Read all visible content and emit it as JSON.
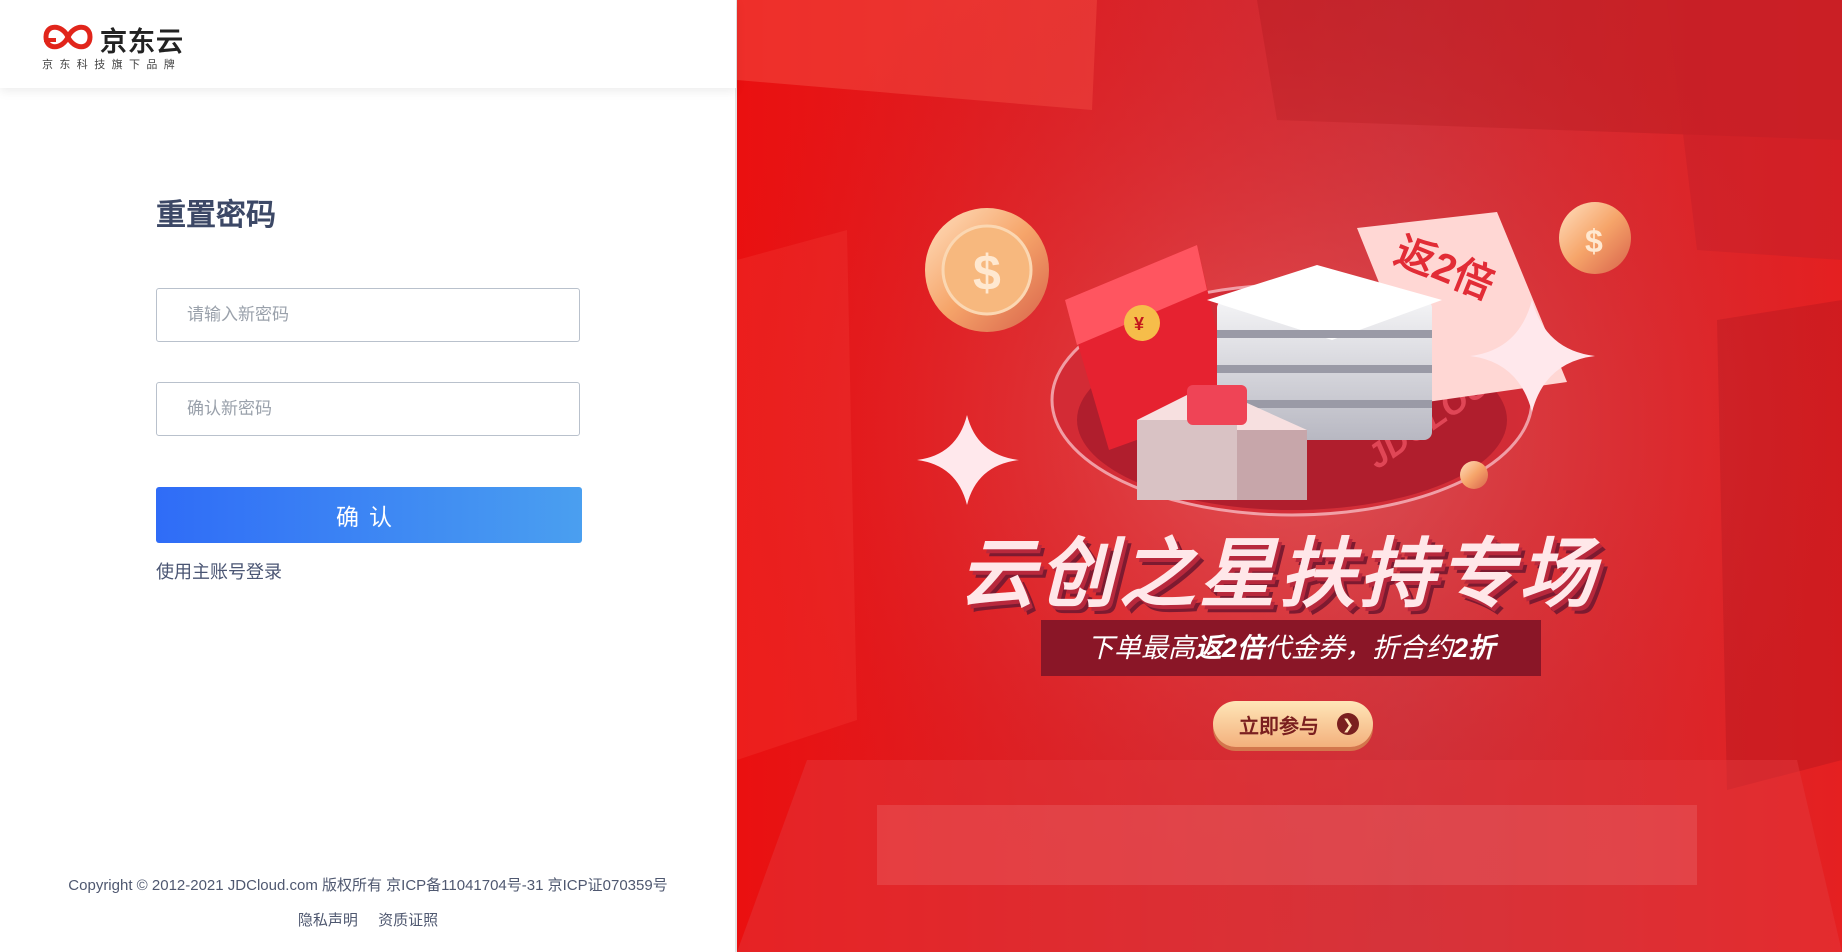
{
  "brand": {
    "name": "京东云",
    "tagline": "京东科技旗下品牌",
    "logo_color": "#e1251b"
  },
  "form": {
    "title": "重置密码",
    "new_password_placeholder": "请输入新密码",
    "confirm_password_placeholder": "确认新密码",
    "confirm_label": "确认",
    "main_account_link": "使用主账号登录",
    "accent_color": "#2f6cf7"
  },
  "footer": {
    "copyright": "Copyright © 2012-2021 JDCloud.com 版权所有 京ICP备11041704号-31 京ICP证070359号",
    "links": [
      "隐私声明",
      "资质证照"
    ]
  },
  "banner": {
    "headline": "云创之星扶持专场",
    "subline_prefix": "下单最高",
    "subline_bold1": "返2倍",
    "subline_middle": "代金券，折合约",
    "subline_bold2": "2折",
    "ticket_text": "返2倍",
    "ribbon_text": "JDCLOUD",
    "join_label": "立即参与",
    "join_arrow_icon": "chevron-right-icon",
    "background_color": "#e51e1e"
  }
}
